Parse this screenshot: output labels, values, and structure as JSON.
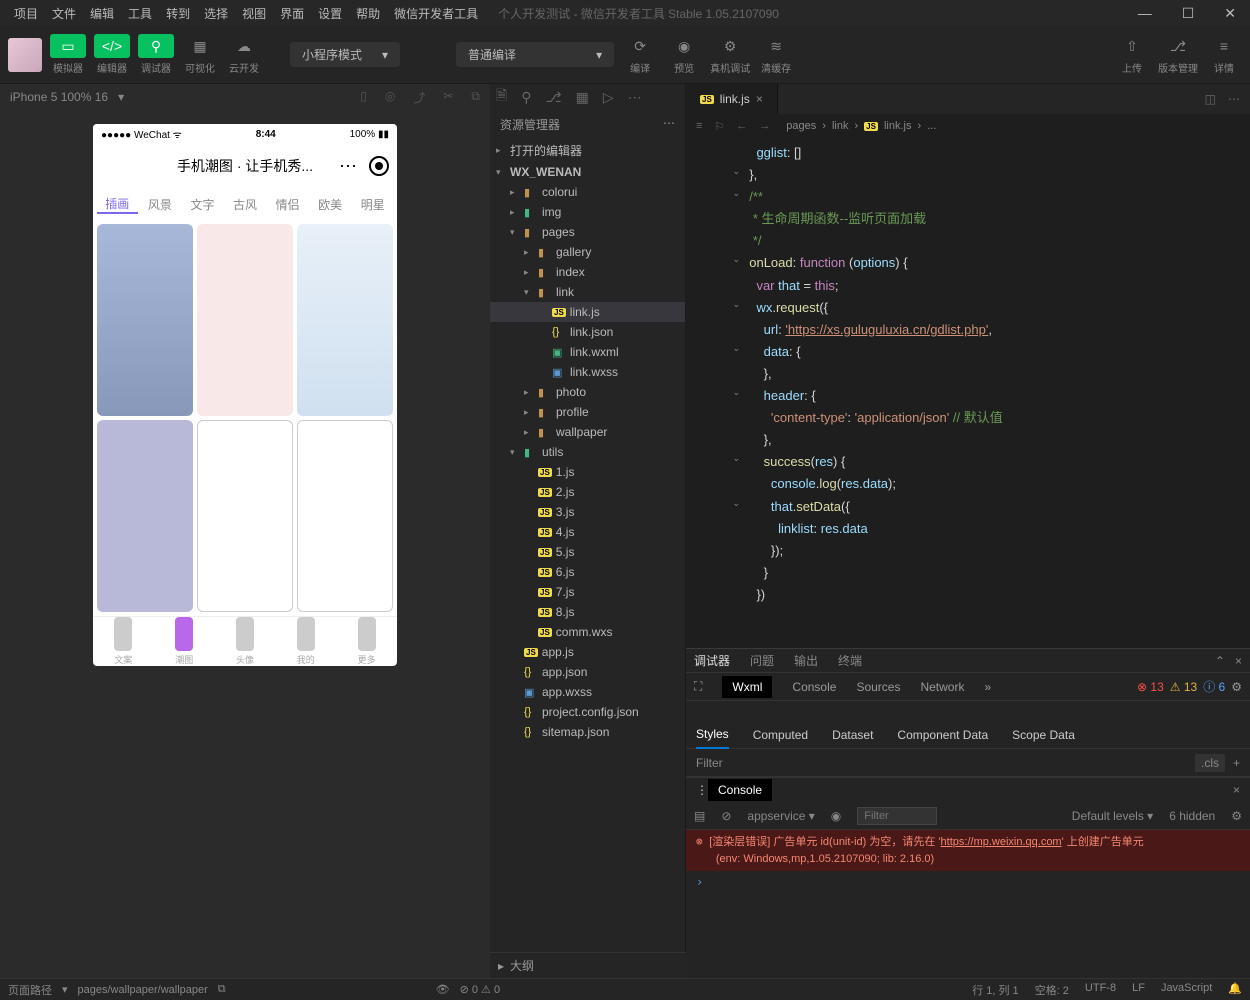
{
  "menubar": [
    "项目",
    "文件",
    "编辑",
    "工具",
    "转到",
    "选择",
    "视图",
    "界面",
    "设置",
    "帮助",
    "微信开发者工具"
  ],
  "title_extra": "个人开发测试 - 微信开发者工具 Stable 1.05.2107090",
  "toolbar_labels": {
    "simulator": "模拟器",
    "editor": "编辑器",
    "debugger": "调试器",
    "visualize": "可视化",
    "cloud": "云开发"
  },
  "mode_dropdown": "小程序模式",
  "compile_dropdown": "普通编译",
  "action_labels": {
    "compile": "编译",
    "preview": "预览",
    "remote": "真机调试",
    "clear": "清缓存",
    "upload": "上传",
    "version": "版本管理",
    "detail": "详情"
  },
  "sim_device": "iPhone 5 100% 16",
  "phone": {
    "time": "8:44",
    "battery": "100%",
    "carrier": "●●●●● WeChat",
    "title": "手机潮图 · 让手机秀...",
    "tabs": [
      "插画",
      "风景",
      "文字",
      "古风",
      "情侣",
      "欧美",
      "明星"
    ],
    "nav": [
      "文案",
      "潮图",
      "头像",
      "我的",
      "更多"
    ]
  },
  "explorer": {
    "title": "资源管理器",
    "open_editors": "打开的编辑器",
    "project": "WX_WENAN",
    "outline": "大纲",
    "tree": {
      "colorui": "colorui",
      "img": "img",
      "pages": "pages",
      "gallery": "gallery",
      "index": "index",
      "link": "link",
      "link_js": "link.js",
      "link_json": "link.json",
      "link_wxml": "link.wxml",
      "link_wxss": "link.wxss",
      "photo": "photo",
      "profile": "profile",
      "wallpaper": "wallpaper",
      "utils": "utils",
      "u1": "1.js",
      "u2": "2.js",
      "u3": "3.js",
      "u4": "4.js",
      "u5": "5.js",
      "u6": "6.js",
      "u7": "7.js",
      "u8": "8.js",
      "comm": "comm.wxs",
      "app_js": "app.js",
      "app_json": "app.json",
      "app_wxss": "app.wxss",
      "config": "project.config.json",
      "sitemap": "sitemap.json"
    }
  },
  "editor": {
    "tab": "link.js",
    "breadcrumb": [
      "pages",
      "link",
      "link.js",
      "..."
    ]
  },
  "code": {
    "gglist": "gglist",
    "comment1": "/**",
    "comment2": " * 生命周期函数--监听页面加载",
    "comment3": " */",
    "onload": "onLoad",
    "function": "function",
    "options": "options",
    "var": "var",
    "that": "that",
    "this": "this",
    "wx": "wx",
    "request": "request",
    "url_key": "url",
    "url_val": "'https://xs.guluguluxia.cn/gdlist.php'",
    "data_key": "data",
    "header_key": "header",
    "ct_key": "'content-type'",
    "ct_val": "'application/json'",
    "ct_comment": "// 默认值",
    "success": "success",
    "res": "res",
    "console": "console",
    "log": "log",
    "setdata": "setData",
    "linklist": "linklist",
    "resdata": "res.data"
  },
  "devtools": {
    "top_tabs": [
      "调试器",
      "问题",
      "输出",
      "终端"
    ],
    "sub_tabs": [
      "Wxml",
      "Console",
      "Sources",
      "Network"
    ],
    "errors": "13",
    "warnings": "13",
    "info": "6",
    "style_tabs": [
      "Styles",
      "Computed",
      "Dataset",
      "Component Data",
      "Scope Data"
    ],
    "filter": "Filter",
    "cls": ".cls"
  },
  "console": {
    "name": "Console",
    "context": "appservice",
    "filter": "Filter",
    "levels": "Default levels",
    "hidden": "6 hidden",
    "error_line1": "[渲染层错误] 广告单元 id(unit-id) 为空，请先在 '",
    "error_url": "https://mp.weixin.qq.com",
    "error_line1b": "' 上创建广告单元",
    "error_line2": "(env: Windows,mp,1.05.2107090; lib: 2.16.0)"
  },
  "statusbar": {
    "path_label": "页面路径",
    "path": "pages/wallpaper/wallpaper",
    "stats": "⊘ 0 ⚠ 0",
    "cursor": "行 1, 列 1",
    "spaces": "空格: 2",
    "encoding": "UTF-8",
    "eol": "LF",
    "lang": "JavaScript"
  }
}
